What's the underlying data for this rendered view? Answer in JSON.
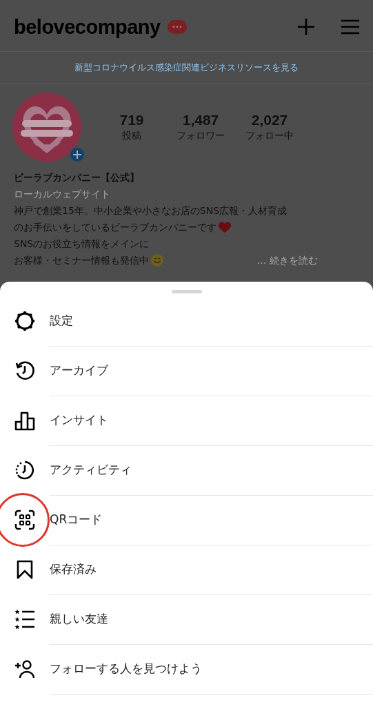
{
  "header": {
    "username": "belovecompany"
  },
  "banner": {
    "link": "新型コロナウイルス感染症関連ビジネスリソースを見る"
  },
  "profile": {
    "stats": [
      {
        "value": "719",
        "label": "投稿"
      },
      {
        "value": "1,487",
        "label": "フォロワー"
      },
      {
        "value": "2,027",
        "label": "フォロー中"
      }
    ],
    "name": "ビーラブカンパニー【公式】",
    "category": "ローカルウェブサイト",
    "bio": [
      {
        "text": "神戸で創業15年。中小企業や小さなお店のSNS広報・人材育成",
        "kind": "plain"
      },
      {
        "text": "のお手伝いをしているビーラブカンパニーです",
        "kind": "heart"
      },
      {
        "text": "SNSのお役立ち情報をメインに",
        "kind": "plain"
      },
      {
        "text": "お客様・セミナー情報も発信中",
        "kind": "smile"
      }
    ],
    "more": "… 続きを読む"
  },
  "menu": {
    "items": [
      {
        "kind": "gear",
        "label": "設定",
        "highlighted": false
      },
      {
        "kind": "archive",
        "label": "アーカイブ",
        "highlighted": false
      },
      {
        "kind": "insights",
        "label": "インサイト",
        "highlighted": false
      },
      {
        "kind": "activity",
        "label": "アクティビティ",
        "highlighted": false
      },
      {
        "kind": "qr",
        "label": "QRコード",
        "highlighted": true
      },
      {
        "kind": "saved",
        "label": "保存済み",
        "highlighted": false
      },
      {
        "kind": "close-friends",
        "label": "親しい友達",
        "highlighted": false
      },
      {
        "kind": "add-person",
        "label": "フォローする人を見つけよう",
        "highlighted": false
      }
    ]
  }
}
